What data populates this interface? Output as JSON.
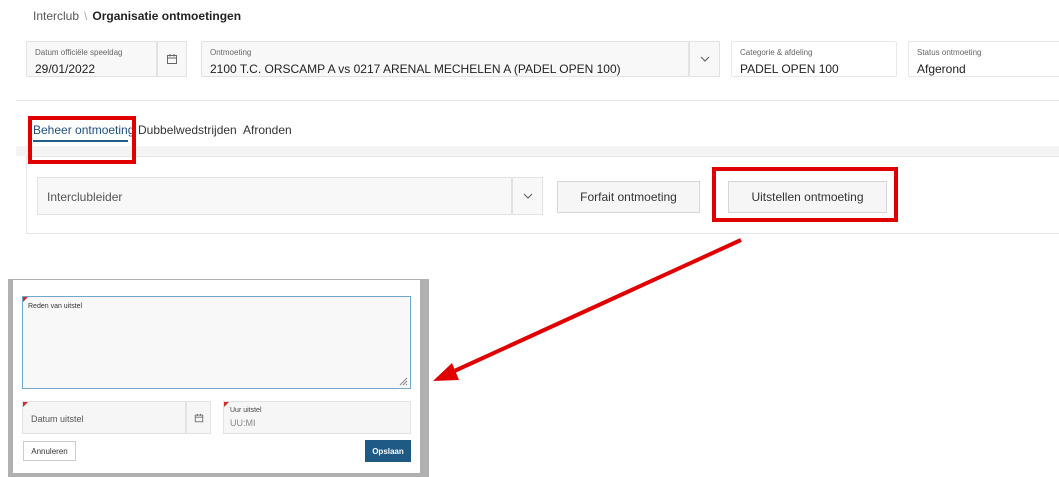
{
  "breadcrumb": {
    "root": "Interclub",
    "separator": "\\",
    "current": "Organisatie ontmoetingen"
  },
  "header": {
    "datum": {
      "label": "Datum officiële speeldag",
      "value": "29/01/2022"
    },
    "ontmoeting": {
      "label": "Ontmoeting",
      "value": "2100 T.C. ORSCAMP A vs 0217 ARENAL MECHELEN A (PADEL OPEN 100)"
    },
    "categorie": {
      "label": "Categorie & afdeling",
      "value": "PADEL OPEN 100"
    },
    "status": {
      "label": "Status ontmoeting",
      "value": "Afgerond"
    }
  },
  "tabs": [
    {
      "label": "Beheer ontmoeting",
      "active": true
    },
    {
      "label": "Dubbelwedstrijden",
      "active": false
    },
    {
      "label": "Afronden",
      "active": false
    }
  ],
  "panel": {
    "select_value": "Interclubleider",
    "forfait_label": "Forfait ontmoeting",
    "uitstellen_label": "Uitstellen ontmoeting"
  },
  "dialog": {
    "reason_label": "Reden van uitstel",
    "date_placeholder": "Datum uitstel",
    "time_label": "Uur uitstel",
    "time_placeholder": "UU:MI",
    "cancel_label": "Annuleren",
    "save_label": "Opslaan"
  },
  "colors": {
    "highlight": "#e00000",
    "accent": "#1e5a84",
    "required_flag": "#d12b2b"
  },
  "icons": [
    "calendar-icon",
    "chevron-down-icon",
    "resize-grip-icon",
    "arrow-annotation"
  ]
}
